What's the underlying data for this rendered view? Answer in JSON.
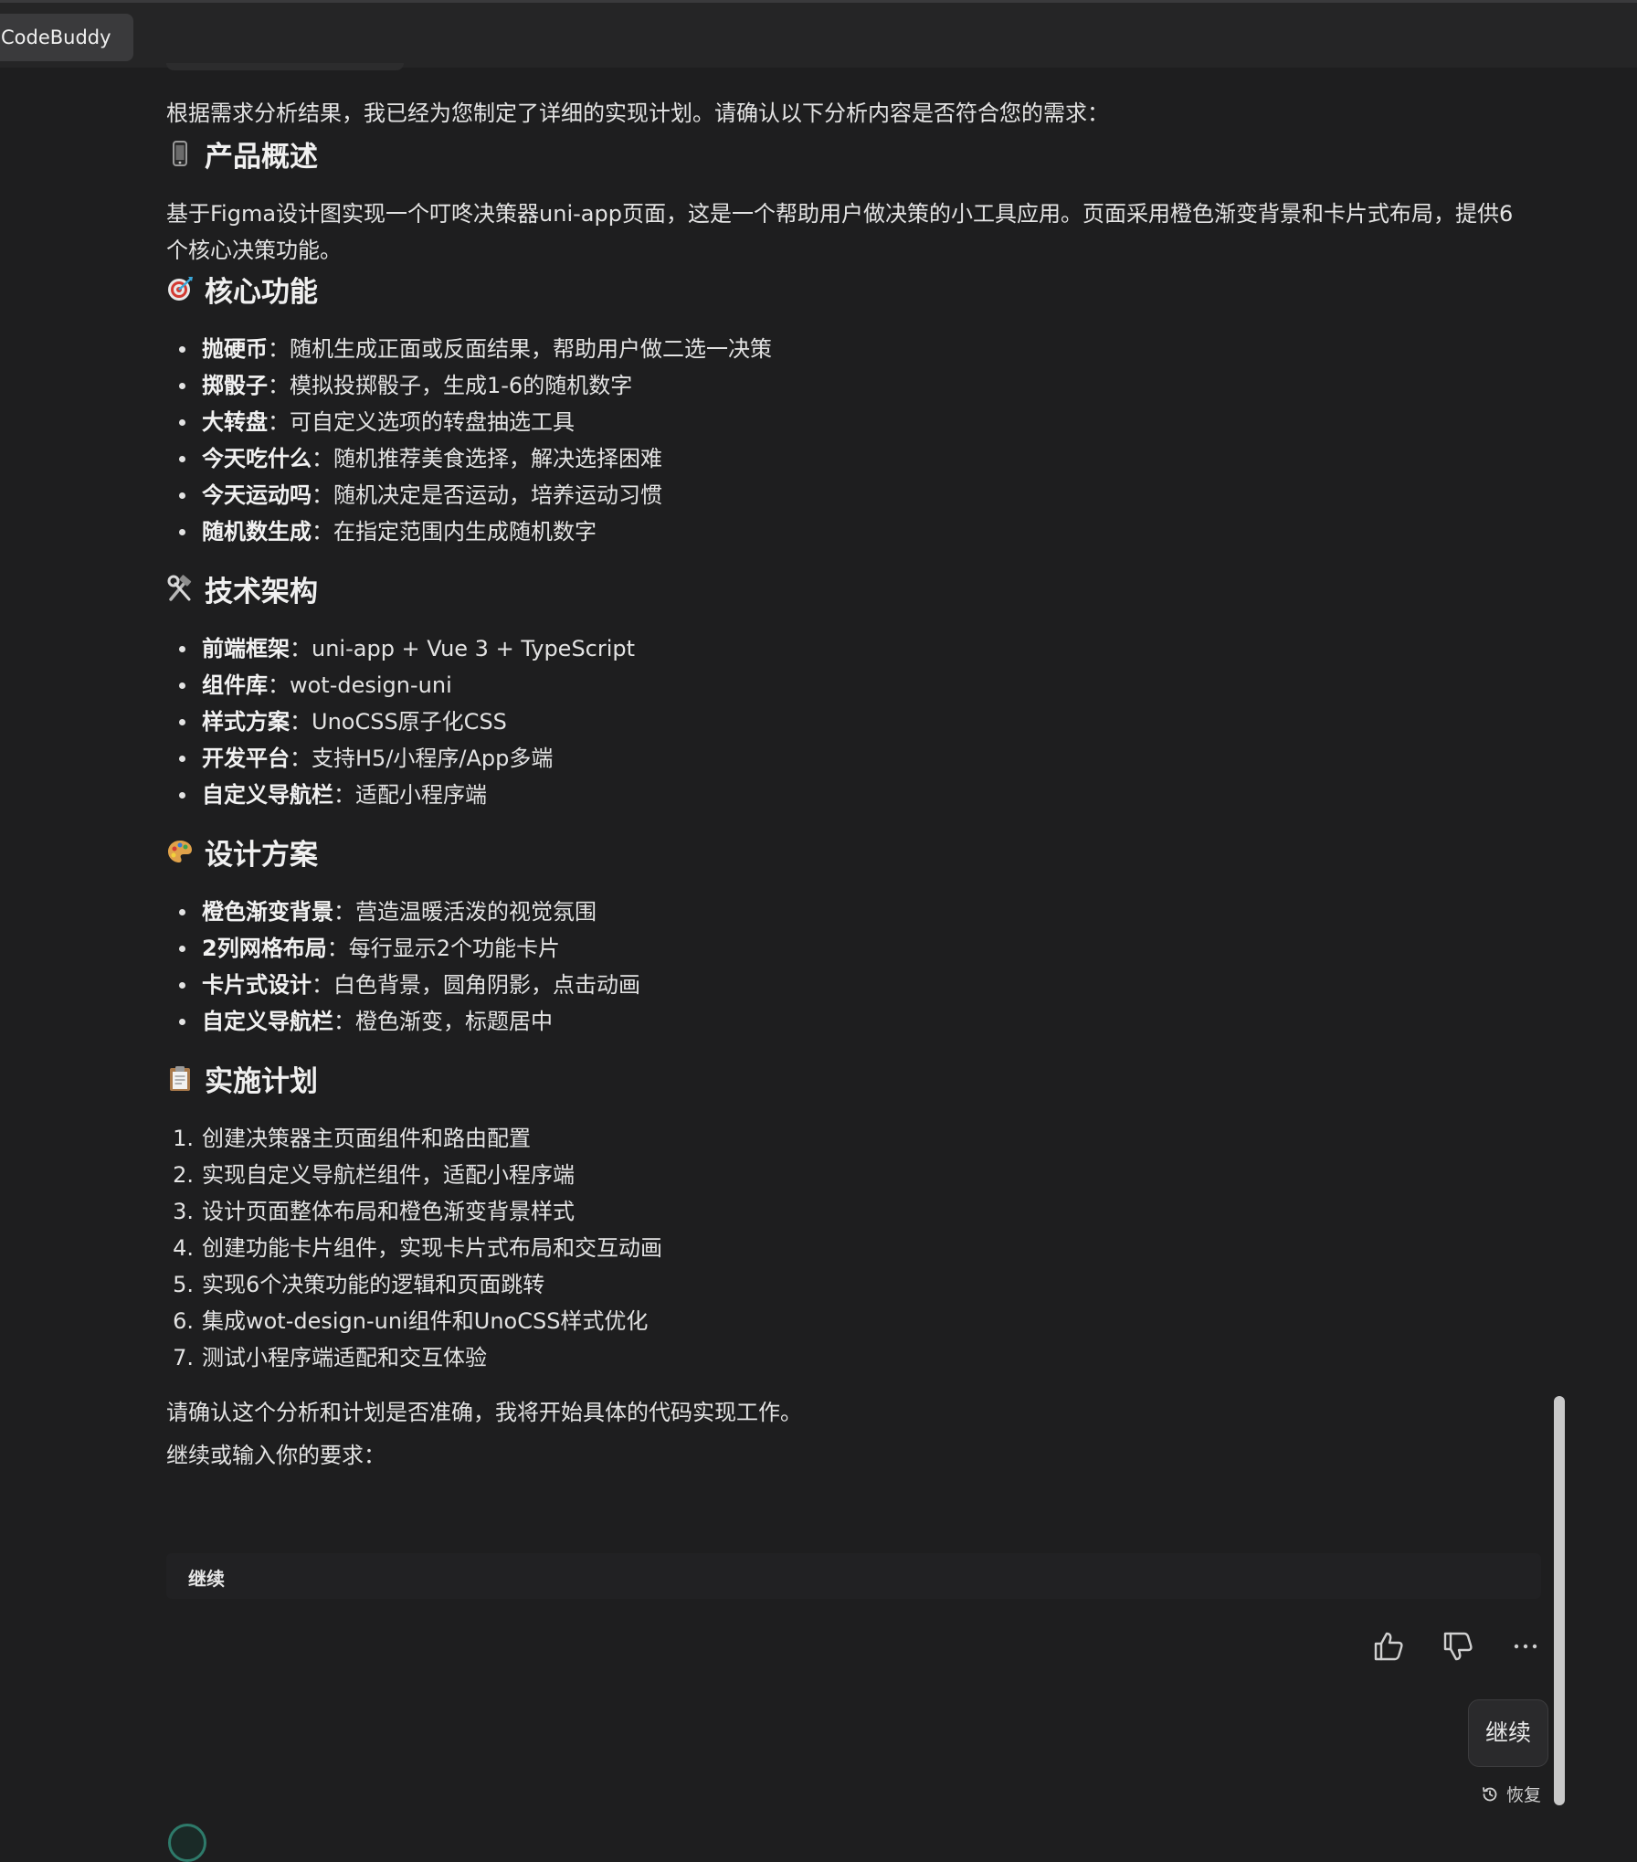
{
  "app": {
    "tab_label": "CodeBuddy"
  },
  "message": {
    "intro": "根据需求分析结果，我已经为您制定了详细的实现计划。请确认以下分析内容是否符合您的需求：",
    "sections": {
      "overview": {
        "title": "产品概述",
        "icon": "mobile-phone-icon",
        "text": "基于Figma设计图实现一个叮咚决策器uni-app页面，这是一个帮助用户做决策的小工具应用。页面采用橙色渐变背景和卡片式布局，提供6个核心决策功能。"
      },
      "features": {
        "title": "核心功能",
        "icon": "target-icon",
        "items": [
          {
            "term": "抛硬币",
            "desc": "：随机生成正面或反面结果，帮助用户做二选一决策"
          },
          {
            "term": "掷骰子",
            "desc": "：模拟投掷骰子，生成1-6的随机数字"
          },
          {
            "term": "大转盘",
            "desc": "：可自定义选项的转盘抽选工具"
          },
          {
            "term": "今天吃什么",
            "desc": "：随机推荐美食选择，解决选择困难"
          },
          {
            "term": "今天运动吗",
            "desc": "：随机决定是否运动，培养运动习惯"
          },
          {
            "term": "随机数生成",
            "desc": "：在指定范围内生成随机数字"
          }
        ]
      },
      "tech": {
        "title": "技术架构",
        "icon": "hammer-wrench-icon",
        "items": [
          {
            "term": "前端框架",
            "desc": "：uni-app + Vue 3 + TypeScript"
          },
          {
            "term": "组件库",
            "desc": "：wot-design-uni"
          },
          {
            "term": "样式方案",
            "desc": "：UnoCSS原子化CSS"
          },
          {
            "term": "开发平台",
            "desc": "：支持H5/小程序/App多端"
          },
          {
            "term": "自定义导航栏",
            "desc": "：适配小程序端"
          }
        ]
      },
      "design": {
        "title": "设计方案",
        "icon": "palette-icon",
        "items": [
          {
            "term": "橙色渐变背景",
            "desc": "：营造温暖活泼的视觉氛围"
          },
          {
            "term": "2列网格布局",
            "desc": "：每行显示2个功能卡片"
          },
          {
            "term": "卡片式设计",
            "desc": "：白色背景，圆角阴影，点击动画"
          },
          {
            "term": "自定义导航栏",
            "desc": "：橙色渐变，标题居中"
          }
        ]
      },
      "plan": {
        "title": "实施计划",
        "icon": "clipboard-icon",
        "steps": [
          {
            "num": "1.",
            "text": "创建决策器主页面组件和路由配置"
          },
          {
            "num": "2.",
            "text": "实现自定义导航栏组件，适配小程序端"
          },
          {
            "num": "3.",
            "text": "设计页面整体布局和橙色渐变背景样式"
          },
          {
            "num": "4.",
            "text": "创建功能卡片组件，实现卡片式布局和交互动画"
          },
          {
            "num": "5.",
            "text": "实现6个决策功能的逻辑和页面跳转"
          },
          {
            "num": "6.",
            "text": "集成wot-design-uni组件和UnoCSS样式优化"
          },
          {
            "num": "7.",
            "text": "测试小程序端适配和交互体验"
          }
        ]
      }
    },
    "confirm_text": "请确认这个分析和计划是否准确，我将开始具体的代码实现工作。",
    "prompt_text": "继续或输入你的要求：",
    "choice_label": "继续"
  },
  "actions": {
    "like_icon": "thumbs-up-icon",
    "dislike_icon": "thumbs-down-icon",
    "more_icon": "more-horizontal-icon"
  },
  "user_bubble": {
    "label": "继续"
  },
  "restore": {
    "label": "恢复",
    "icon": "history-icon"
  }
}
